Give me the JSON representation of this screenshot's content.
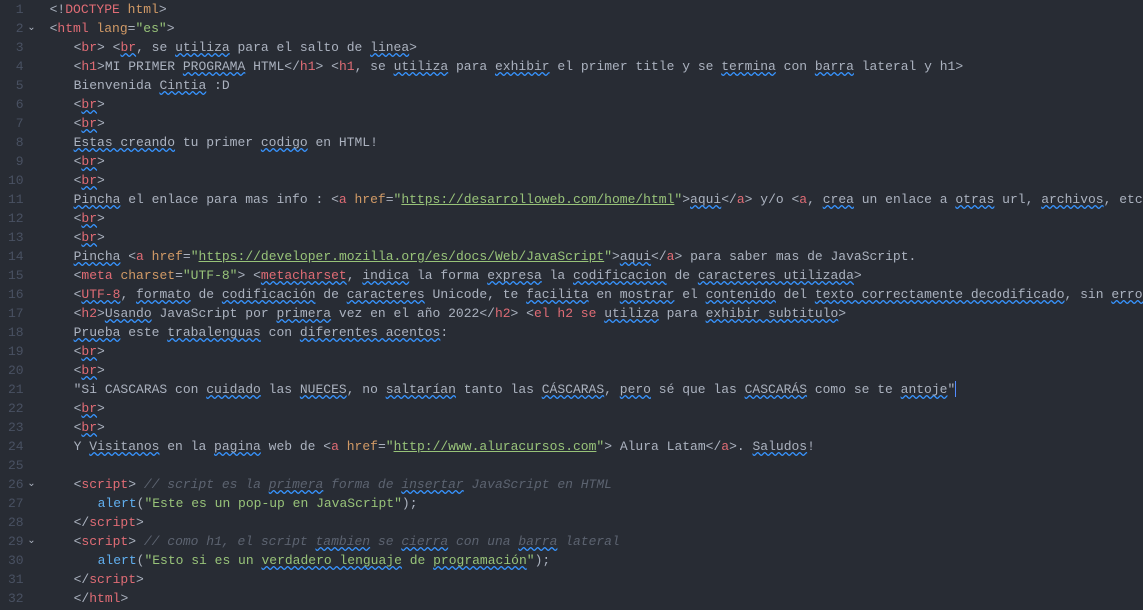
{
  "lines": [
    {
      "num": "1",
      "fold": false
    },
    {
      "num": "2",
      "fold": true
    },
    {
      "num": "3",
      "fold": false
    },
    {
      "num": "4",
      "fold": false
    },
    {
      "num": "5",
      "fold": false
    },
    {
      "num": "6",
      "fold": false
    },
    {
      "num": "7",
      "fold": false
    },
    {
      "num": "8",
      "fold": false
    },
    {
      "num": "9",
      "fold": false
    },
    {
      "num": "10",
      "fold": false
    },
    {
      "num": "11",
      "fold": false
    },
    {
      "num": "12",
      "fold": false
    },
    {
      "num": "13",
      "fold": false
    },
    {
      "num": "14",
      "fold": false
    },
    {
      "num": "15",
      "fold": false
    },
    {
      "num": "16",
      "fold": false
    },
    {
      "num": "17",
      "fold": false
    },
    {
      "num": "18",
      "fold": false
    },
    {
      "num": "19",
      "fold": false
    },
    {
      "num": "20",
      "fold": false
    },
    {
      "num": "21",
      "fold": false
    },
    {
      "num": "22",
      "fold": false
    },
    {
      "num": "23",
      "fold": false
    },
    {
      "num": "24",
      "fold": false
    },
    {
      "num": "25",
      "fold": false
    },
    {
      "num": "26",
      "fold": true
    },
    {
      "num": "27",
      "fold": false
    },
    {
      "num": "28",
      "fold": false
    },
    {
      "num": "29",
      "fold": true
    },
    {
      "num": "30",
      "fold": false
    },
    {
      "num": "31",
      "fold": false
    },
    {
      "num": "32",
      "fold": false
    }
  ],
  "content": {
    "l1": {
      "doctype": "<!DOCTYPE html>"
    },
    "l2": {
      "open": "<",
      "tag": "html",
      "attr": "lang",
      "val": "\"es\"",
      "close": ">"
    },
    "l3": {
      "br1": "br",
      "comment_br": "br",
      "text1": ", se ",
      "wavy1": "utiliza",
      "text2": " para el salto de ",
      "wavy2": "linea"
    },
    "l4": {
      "tag": "h1",
      "content": "MI PRIMER ",
      "wavy1": "PROGRAMA",
      "content2": " HTML",
      "comment_tag": "h1",
      "c1": ", se ",
      "cw1": "utiliza",
      "c2": " para ",
      "cw2": "exhibir",
      "c3": " el primer title y se ",
      "cw3": "termina",
      "c4": " con ",
      "cw4": "barra",
      "c5": " lateral y h1"
    },
    "l5": {
      "text1": "Bienvenida ",
      "wavy1": "Cintia",
      "text2": " :D"
    },
    "l6": {
      "tag": "br"
    },
    "l7": {
      "tag": "br"
    },
    "l8": {
      "wavy1": "Estas creando",
      "text1": " tu primer ",
      "wavy2": "codigo",
      "text2": " en HTML!"
    },
    "l9": {
      "tag": "br"
    },
    "l10": {
      "tag": "br"
    },
    "l11": {
      "wavy1": "Pincha",
      "text1": " el enlace para mas info : ",
      "tag": "a",
      "attr": "href",
      "url": "https://desarrolloweb.com/home/html",
      "linktext": "aqui",
      "text2": " y/o ",
      "tag2": "a",
      "c1": ", ",
      "cw1": "crea",
      "c2": " un enlace a ",
      "cw2": "otras",
      "c3": " url, ",
      "cw3": "archivos",
      "c4": ", etc"
    },
    "l12": {
      "tag": "br"
    },
    "l13": {
      "tag": "br"
    },
    "l14": {
      "wavy1": "Pincha",
      "tag": "a",
      "attr": "href",
      "url": "https://developer.mozilla.org/es/docs/Web/JavaScript",
      "linktext": "aqui",
      "text2": " para saber mas de JavaScript."
    },
    "l15": {
      "tag": "meta",
      "attr": "charset",
      "val": "\"UTF-8\"",
      "cw1": "metacharset",
      "c1": ", ",
      "cw2": "indica",
      "c2": " la forma ",
      "cw3": "expresa",
      "c3": " la ",
      "cw4": "codificacion",
      "c4": " de ",
      "cw5": "caracteres utilizada"
    },
    "l16": {
      "cw1": "UTF-8",
      "c1": ", ",
      "cw2": "formato",
      "c2": " de ",
      "cw3": "codificación",
      "c3": " de ",
      "cw4": "caracteres",
      "c4": " Unicode, te ",
      "cw5": "facilita",
      "c5": " en ",
      "cw6": "mostrar",
      "c6": " el ",
      "cw7": "contenido",
      "c7": " del ",
      "cw8": "texto correctamente decodificado",
      "c8": ", sin ",
      "cw9": "errores"
    },
    "l17": {
      "tag": "h2",
      "wavy1": "Usando",
      "text1": " JavaScript por ",
      "wavy2": "primera",
      "text2": " vez en el año 2022",
      "c1": "el h2 se ",
      "cw1": "utiliza",
      "c2": " para ",
      "cw2": "exhibir subtitulo"
    },
    "l18": {
      "wavy1": "Prueba",
      "text1": " este ",
      "wavy2": "trabalenguas",
      "text2": " con ",
      "wavy3": "diferentes acentos",
      "text3": ":"
    },
    "l19": {
      "tag": "br"
    },
    "l20": {
      "tag": "br"
    },
    "l21": {
      "text1": "\"Si CASCARAS con ",
      "wavy1": "cuidado",
      "text2": " las ",
      "wavy2": "NUECES",
      "text3": ", no ",
      "wavy3": "saltarían",
      "text4": " tanto las ",
      "wavy4": "CÁSCARAS",
      "text5": ", ",
      "wavy5": "pero",
      "text6": " sé que las ",
      "wavy6": "CASCARÁS",
      "text7": " como se te ",
      "wavy7": "antoje",
      "text8": "\""
    },
    "l22": {
      "tag": "br"
    },
    "l23": {
      "tag": "br"
    },
    "l24": {
      "text1": "Y ",
      "wavy1": "Visitanos",
      "text2": " en la ",
      "wavy2": "pagina",
      "text3": " web de ",
      "tag": "a",
      "attr": "href",
      "url": "http://www.aluracursos.com",
      "linktext": " Alura Latam",
      "text4": ". ",
      "wavy3": "Saludos",
      "text5": "!"
    },
    "l26": {
      "tag": "script",
      "comment": "// script es la ",
      "cw1": "primera",
      "c2": " forma de ",
      "cw2": "insertar",
      "c3": " JavaScript en HTML"
    },
    "l27": {
      "func": "alert",
      "string": "\"Este es un pop-up en JavaScript\""
    },
    "l28": {
      "tag": "script"
    },
    "l29": {
      "tag": "script",
      "comment": "// como h1, el script ",
      "cw1": "tambien",
      "c2": " se ",
      "cw2": "cierra",
      "c3": " con una ",
      "cw3": "barra",
      "c4": " lateral"
    },
    "l30": {
      "func": "alert",
      "s1": "\"Esto si es un ",
      "sw1": "verdadero lenguaje",
      "s2": " de ",
      "sw2": "programación",
      "s3": "\""
    },
    "l31": {
      "tag": "script"
    },
    "l32": {
      "tag": "html"
    }
  }
}
